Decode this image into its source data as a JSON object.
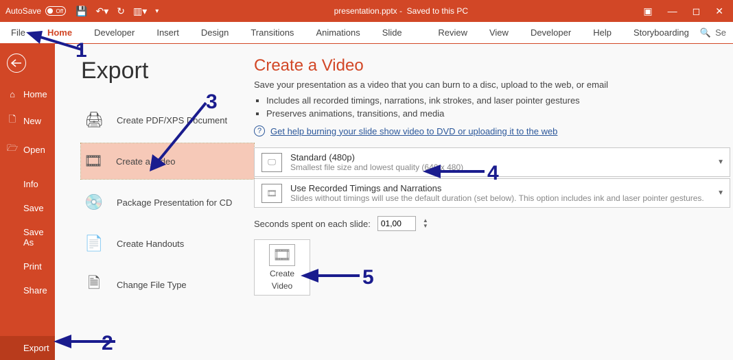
{
  "titlebar": {
    "autosave_label": "AutoSave",
    "autosave_toggle": "Off",
    "filename": "presentation.pptx",
    "saved_state": "Saved to this PC"
  },
  "ribbon": {
    "tabs": [
      "File",
      "Home",
      "Developer",
      "Insert",
      "Design",
      "Transitions",
      "Animations",
      "Slide Show",
      "Review",
      "View",
      "Developer",
      "Help",
      "Storyboarding"
    ],
    "search_label": "Se"
  },
  "sidebar": {
    "items": [
      {
        "label": "Home",
        "icon": "home"
      },
      {
        "label": "New",
        "icon": "doc"
      },
      {
        "label": "Open",
        "icon": "folder"
      },
      {
        "label": "Info"
      },
      {
        "label": "Save"
      },
      {
        "label": "Save As"
      },
      {
        "label": "Print"
      },
      {
        "label": "Share"
      },
      {
        "label": "Export",
        "active": true
      }
    ]
  },
  "export": {
    "title": "Export",
    "options": [
      {
        "label": "Create PDF/XPS Document",
        "icon": "pdf"
      },
      {
        "label": "Create a Video",
        "icon": "video",
        "active": true
      },
      {
        "label": "Package Presentation for CD",
        "icon": "cd"
      },
      {
        "label": "Create Handouts",
        "icon": "handout"
      },
      {
        "label": "Change File Type",
        "icon": "filetype"
      }
    ]
  },
  "detail": {
    "heading": "Create a Video",
    "sub": "Save your presentation as a video that you can burn to a disc, upload to the web, or email",
    "bullets": [
      "Includes all recorded timings, narrations, ink strokes, and laser pointer gestures",
      "Preserves animations, transitions, and media"
    ],
    "help_link": "Get help burning your slide show video to DVD or uploading it to the web",
    "quality": {
      "title": "Standard (480p)",
      "sub": "Smallest file size and lowest quality (640 x 480)"
    },
    "timings": {
      "title": "Use Recorded Timings and Narrations",
      "sub": "Slides without timings will use the default duration (set below). This option includes ink and laser pointer gestures."
    },
    "seconds_label": "Seconds spent on each slide:",
    "seconds_value": "01,00",
    "button": {
      "line1": "Create",
      "line2": "Video"
    }
  },
  "annotations": {
    "n1": "1",
    "n2": "2",
    "n3": "3",
    "n4": "4",
    "n5": "5"
  }
}
